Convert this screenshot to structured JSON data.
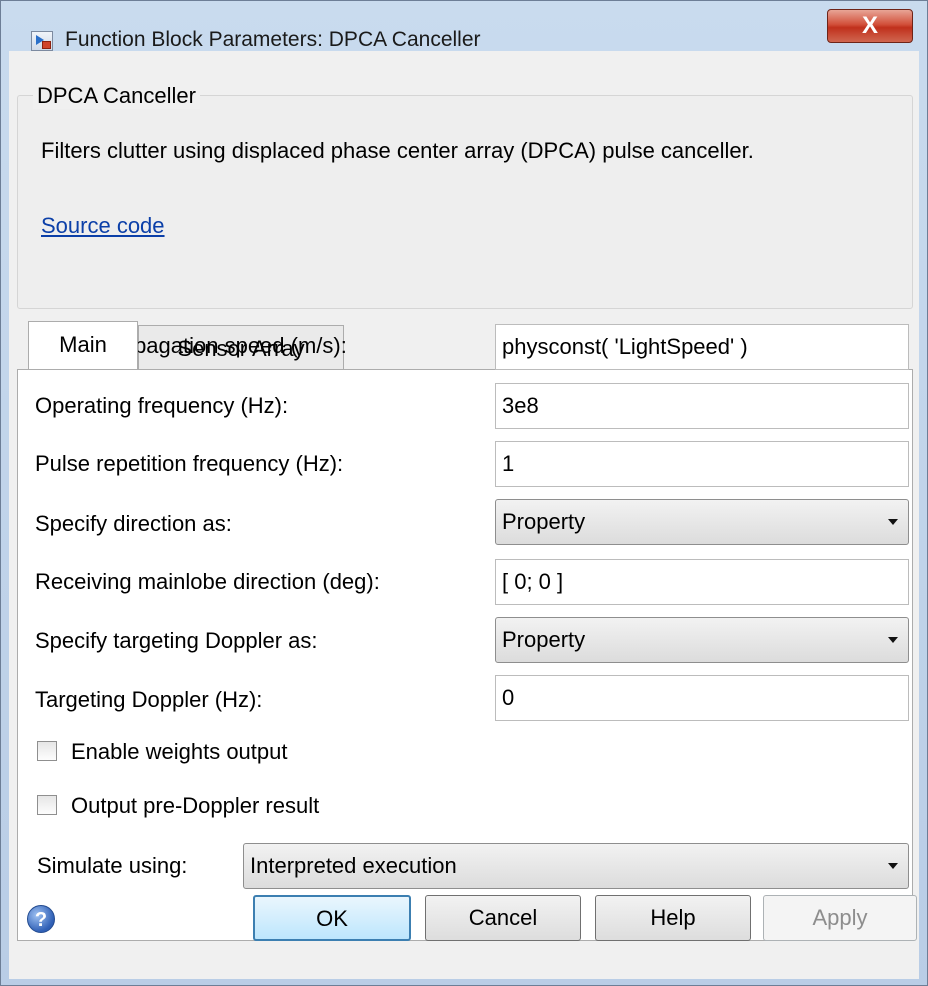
{
  "window": {
    "title": "Function Block Parameters: DPCA Canceller",
    "close_glyph": "X",
    "icon": "simulink-block-icon"
  },
  "group": {
    "title": "DPCA Canceller",
    "description": "Filters clutter using displaced phase center array (DPCA) pulse canceller.",
    "link": "Source code"
  },
  "tabs": [
    {
      "label": "Main",
      "selected": true
    },
    {
      "label": "Sensor Array",
      "selected": false
    }
  ],
  "params": {
    "signal_speed": {
      "label": "Signal propagation speed (m/s):",
      "value": "physconst( 'LightSpeed' )"
    },
    "op_freq": {
      "label": "Operating frequency (Hz):",
      "value": "3e8"
    },
    "prf": {
      "label": "Pulse repetition frequency (Hz):",
      "value": "1"
    },
    "direction_source": {
      "label": "Specify direction as:",
      "value": "Property"
    },
    "mainlobe_dir": {
      "label": "Receiving mainlobe direction (deg):",
      "value": "[ 0; 0 ]"
    },
    "doppler_source": {
      "label": "Specify targeting Doppler as:",
      "value": "Property"
    },
    "doppler": {
      "label": "Targeting Doppler (Hz):",
      "value": "0"
    },
    "weights_output": {
      "label": "Enable weights output",
      "checked": false
    },
    "pre_doppler": {
      "label": "Output pre-Doppler result",
      "checked": false
    },
    "simulate": {
      "label": "Simulate using:",
      "value": "Interpreted execution"
    }
  },
  "buttons": {
    "ok": "OK",
    "cancel": "Cancel",
    "help": "Help",
    "apply": "Apply"
  },
  "colors": {
    "link": "#0b3fa8",
    "close_button": "#c0301c",
    "titlebar": "#c9dbee"
  }
}
